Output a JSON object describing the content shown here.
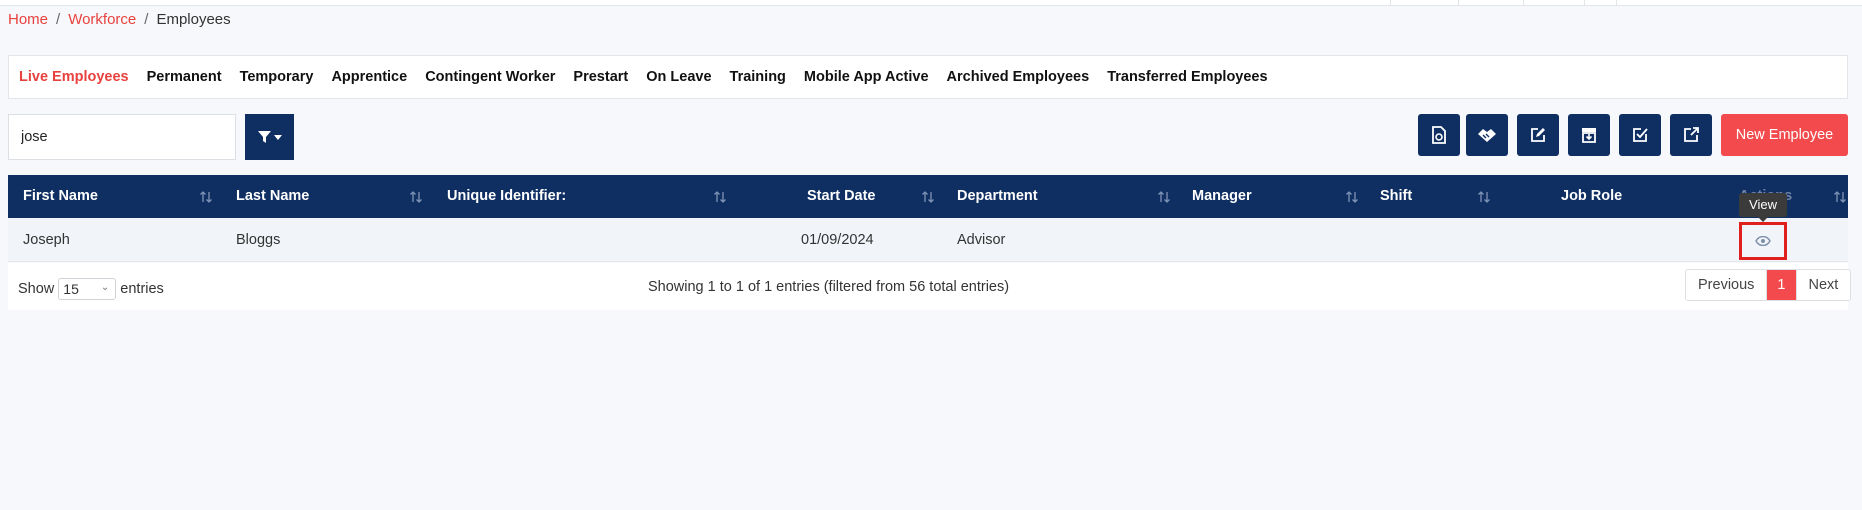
{
  "breadcrumb": {
    "home": "Home",
    "workforce": "Workforce",
    "current": "Employees",
    "separator": "/"
  },
  "tabs": [
    {
      "label": "Live Employees",
      "active": true
    },
    {
      "label": "Permanent"
    },
    {
      "label": "Temporary"
    },
    {
      "label": "Apprentice"
    },
    {
      "label": "Contingent Worker"
    },
    {
      "label": "Prestart"
    },
    {
      "label": "On Leave"
    },
    {
      "label": "Training"
    },
    {
      "label": "Mobile App Active"
    },
    {
      "label": "Archived Employees"
    },
    {
      "label": "Transferred Employees"
    }
  ],
  "search": {
    "value": "jose"
  },
  "toolbar": {
    "new_employee_label": "New Employee"
  },
  "table": {
    "columns": [
      "First Name",
      "Last Name",
      "Unique Identifier:",
      "Start Date",
      "Department",
      "Manager",
      "Shift",
      "Job Role",
      "Actions"
    ],
    "rows": [
      {
        "first_name": "Joseph",
        "last_name": "Bloggs",
        "unique_identifier": "",
        "start_date": "01/09/2024",
        "department": "Advisor",
        "manager": "",
        "shift": "",
        "job_role": ""
      }
    ]
  },
  "tooltip": {
    "view": "View"
  },
  "footer": {
    "show_label": "Show",
    "page_size": "15",
    "entries_label": "entries",
    "info": "Showing 1 to 1 of 1 entries (filtered from 56 total entries)",
    "previous": "Previous",
    "current_page": "1",
    "next": "Next"
  },
  "colors": {
    "navy": "#0f2f63",
    "accent": "#f24a4d",
    "link": "#e8423f"
  }
}
